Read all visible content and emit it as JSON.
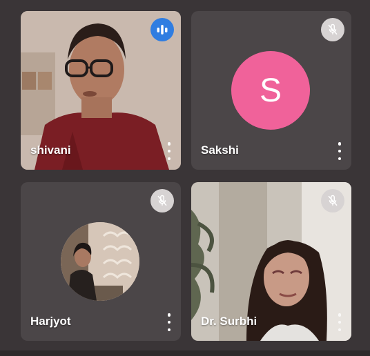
{
  "participants": [
    {
      "name": "shivani",
      "mic": "speaking",
      "view": "video"
    },
    {
      "name": "Sakshi",
      "mic": "muted",
      "view": "avatar-letter",
      "avatar_letter": "S",
      "avatar_color": "#f0629a"
    },
    {
      "name": "Harjyot",
      "mic": "muted",
      "view": "avatar-photo"
    },
    {
      "name": "Dr. Surbhi",
      "mic": "muted",
      "view": "video"
    }
  ],
  "icons": {
    "speaking": "audio-level-icon",
    "muted": "mic-off-icon",
    "more": "more-vert-icon"
  },
  "colors": {
    "background": "#3a3537",
    "tile": "#4b4648",
    "speaking_badge": "#2f7de1",
    "muted_badge": "#d7d3d3"
  }
}
